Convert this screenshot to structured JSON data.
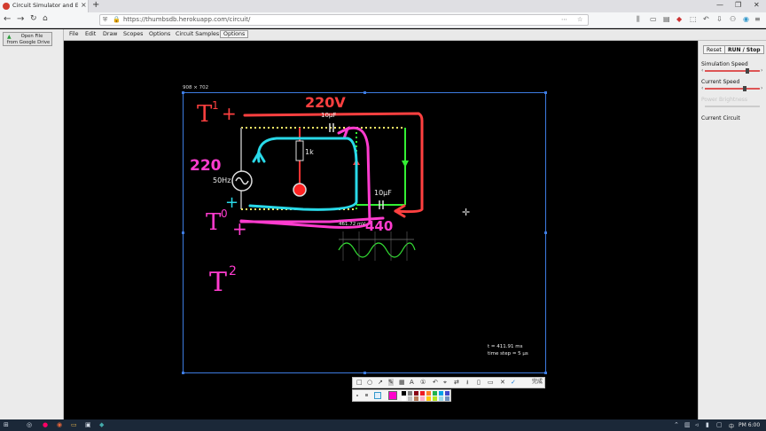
{
  "browser": {
    "tab_title": "Circuit Simulator and Editor",
    "tab_close": "×",
    "new_tab": "+",
    "url": "https://thumbsdb.herokuapp.com/circuit/",
    "window_controls": [
      "—",
      "❐",
      "✕"
    ]
  },
  "app": {
    "open_file_line1": "Open File",
    "open_file_line2": "from Google Drive",
    "menu": [
      "File",
      "Edit",
      "Draw",
      "Scopes",
      "Options",
      "Circuit Samples",
      "Options"
    ],
    "reset_label": "Reset",
    "run_stop_label": "RUN / Stop",
    "sim_speed_label": "Simulation Speed",
    "sim_speed_level": 0.78,
    "current_speed_label": "Current Speed",
    "current_speed_level": 0.72,
    "power_brightness_label": "Power Brightness",
    "current_circuit_label": "Current Circuit"
  },
  "canvas": {
    "selection_size": "908 × 702",
    "components": {
      "source_label": "50Hz",
      "resistor_label": "1k",
      "cap_top_label": "10μF",
      "cap_bottom_label": "10μF",
      "scope_value": "461.72 mV"
    },
    "time_text": "t = 411.91 ms",
    "time_step_text": "time step = 5 μs",
    "annotations": {
      "t1": "T",
      "t1_sup": "1",
      "t1_plus": "+",
      "volt_220v": "220V",
      "v220": "220",
      "t0": "T",
      "t0_sup": "0",
      "t0_plus": "+",
      "v440": "440",
      "t2": "T",
      "t2_sup": "2"
    },
    "wire_colors": {
      "grey": "#888888",
      "green": "#33ee33",
      "red": "#ff3333",
      "yellow": "#ffee66"
    },
    "ink_colors": {
      "red": "#ff4040",
      "magenta": "#ff3ccf",
      "cyan": "#29d9e8"
    }
  },
  "annotation_toolbar": {
    "done_label": "完成",
    "tools": [
      "rect-icon",
      "ellipse-icon",
      "arrow-icon",
      "pen-icon",
      "mosaic-icon",
      "text-icon",
      "number-icon",
      "undo-icon",
      "pin-icon",
      "translate-icon",
      "save-icon",
      "copy-icon",
      "bookmark-icon",
      "cancel-icon",
      "confirm-icon"
    ],
    "active_color": "#ff00cc",
    "swatches": [
      "#000000",
      "#7f7f7f",
      "#880015",
      "#ed1c24",
      "#ff7f27",
      "#22b14c",
      "#00a2e8",
      "#3f48cc",
      "#ffffff",
      "#c3c3c3",
      "#b97a57",
      "#ffaec9",
      "#ffc90e",
      "#b5e61d",
      "#99d9ea",
      "#7092be"
    ]
  },
  "taskbar": {
    "lang": "中",
    "time": "PM 6:00"
  }
}
